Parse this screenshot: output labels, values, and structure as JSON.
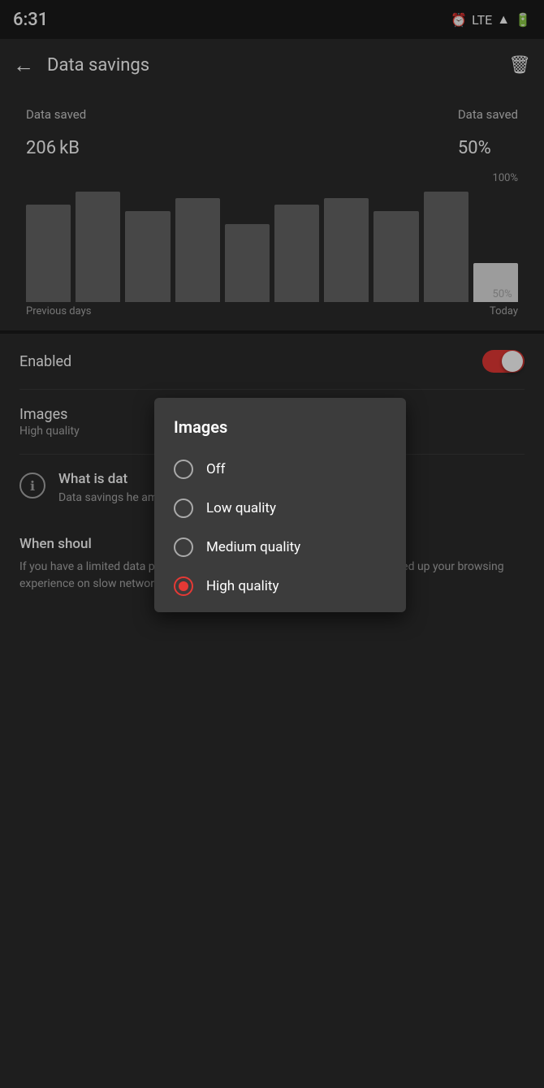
{
  "statusBar": {
    "time": "6:31",
    "icons": [
      "alarm",
      "lte",
      "signal",
      "battery"
    ]
  },
  "topBar": {
    "title": "Data savings",
    "backLabel": "←",
    "trashLabel": "🗑"
  },
  "dataSaved": {
    "leftLabel": "Data saved",
    "leftValue": "206",
    "leftUnit": "kB",
    "rightLabel": "Data saved",
    "rightValue": "50",
    "rightUnit": "%"
  },
  "chart": {
    "bars": [
      75,
      85,
      70,
      80,
      60,
      75,
      80,
      70,
      85,
      30
    ],
    "highlightIndex": 9,
    "yLabels": [
      "100%",
      "50%"
    ],
    "xLabels": [
      "Previous days",
      "Today"
    ]
  },
  "settings": {
    "enabledLabel": "Enabled",
    "imagesLabel": "Images",
    "imagesQuality": "High quality",
    "toggleOn": true
  },
  "infoSection": {
    "title": "What is dat",
    "description": "Data savings he amount of data needed to lo"
  },
  "whenSection": {
    "title": "When shoul",
    "description": "If you have a limited data plan and want to save money, or if you want to speed up your browsing experience on slow network connections, you should enable data savings."
  },
  "dialog": {
    "title": "Images",
    "options": [
      {
        "label": "Off",
        "selected": false
      },
      {
        "label": "Low quality",
        "selected": false
      },
      {
        "label": "Medium quality",
        "selected": false
      },
      {
        "label": "High quality",
        "selected": true
      }
    ]
  }
}
